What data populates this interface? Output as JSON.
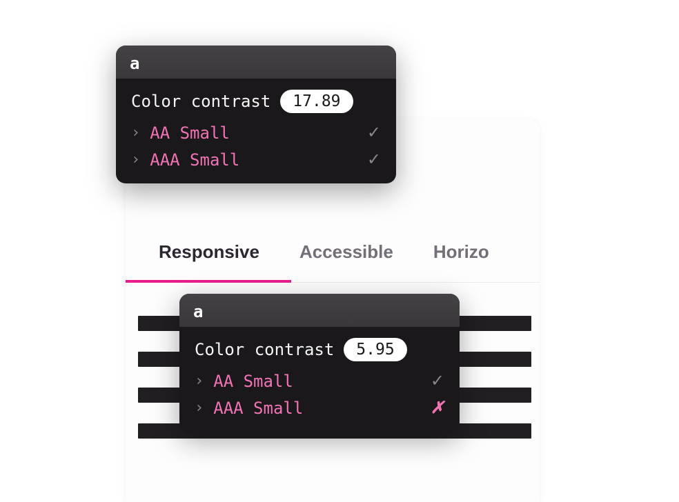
{
  "tabs": {
    "items": [
      {
        "label": "Responsive",
        "active": true
      },
      {
        "label": "Accessible",
        "active": false
      },
      {
        "label": "Horizo",
        "active": false
      }
    ]
  },
  "tooltips": {
    "top": {
      "header_glyph": "a",
      "title": "Color contrast",
      "ratio": "17.89",
      "criteria": [
        {
          "chevron": "›",
          "label": "AA Small",
          "pass": true
        },
        {
          "chevron": "›",
          "label": "AAA Small",
          "pass": true
        }
      ]
    },
    "bottom": {
      "header_glyph": "a",
      "title": "Color contrast",
      "ratio": "5.95",
      "criteria": [
        {
          "chevron": "›",
          "label": "AA Small",
          "pass": true
        },
        {
          "chevron": "›",
          "label": "AAA Small",
          "pass": false
        }
      ]
    }
  },
  "icons": {
    "check": "✓",
    "cross": "✗"
  },
  "colors": {
    "accent": "#e91e8c",
    "criteria_text": "#f074b3",
    "tooltip_bg": "#1a181b",
    "tooltip_header": "#3c393d"
  }
}
